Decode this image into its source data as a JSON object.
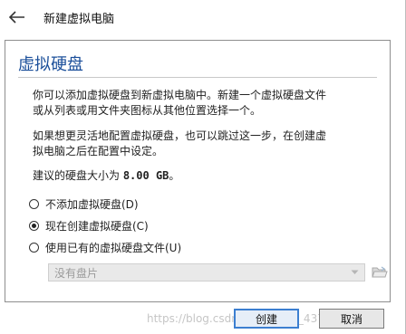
{
  "window": {
    "title": "新建虚拟电脑"
  },
  "page": {
    "heading": "虚拟硬盘",
    "paragraph1_line1": "你可以添加虚拟硬盘到新虚拟电脑中。新建一个虚拟硬盘文件",
    "paragraph1_line2": "或从列表或用文件夹图标从其他位置选择一个。",
    "paragraph2_line1": "如果想更灵活地配置虚拟硬盘，也可以跳过这一步，在创建虚",
    "paragraph2_line2": "拟电脑之后在配置中设定。",
    "recommend_prefix": "建议的硬盘大小为 ",
    "recommend_size": "8.00 GB",
    "recommend_suffix": "。"
  },
  "options": [
    {
      "label": "不添加虚拟硬盘(D)",
      "checked": false
    },
    {
      "label": "现在创建虚拟硬盘(C)",
      "checked": true
    },
    {
      "label": "使用已有的虚拟硬盘文件(U)",
      "checked": false
    }
  ],
  "disk_select": {
    "value": "没有盘片",
    "enabled": false
  },
  "buttons": {
    "create": "创建",
    "cancel": "取消"
  },
  "watermark": "https://blog.csdn.net/weixin_43746678",
  "icons": {
    "back": "arrow-left-icon",
    "dropdown": "chevron-down-icon",
    "folder": "folder-open-icon"
  },
  "colors": {
    "heading": "#1b4f9a",
    "primary_border": "#3c7fd1",
    "disabled_bg": "#e9e9e9"
  }
}
